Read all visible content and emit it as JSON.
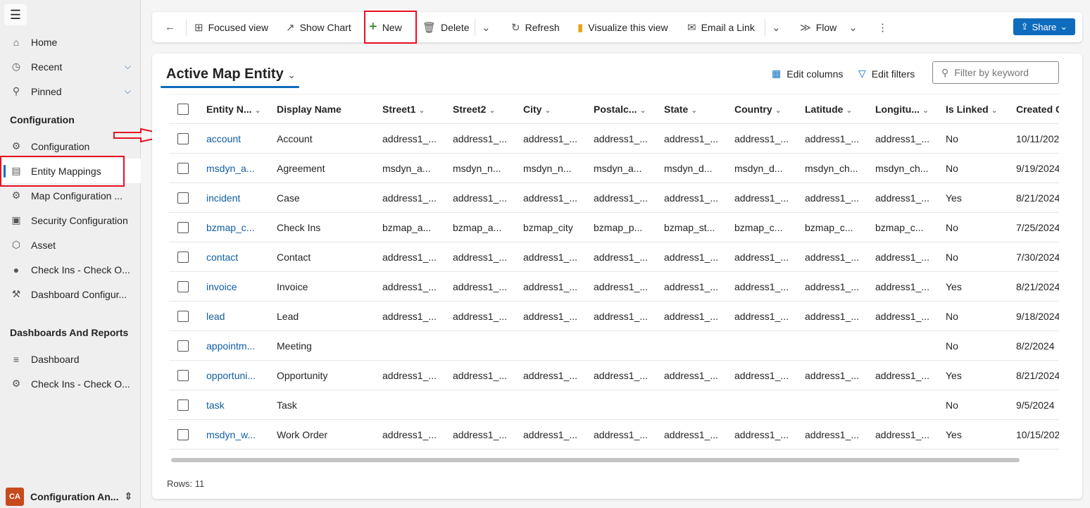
{
  "sidebar": {
    "items": [
      {
        "label": "Home",
        "icon": "home-icon"
      },
      {
        "label": "Recent",
        "icon": "clock-icon"
      },
      {
        "label": "Pinned",
        "icon": "pin-icon"
      }
    ],
    "section1": "Configuration",
    "config_items": [
      {
        "label": "Configuration",
        "icon": "clipboard-gear-icon"
      },
      {
        "label": "Entity Mappings",
        "icon": "document-icon"
      },
      {
        "label": "Map Configuration ...",
        "icon": "gear-icon"
      },
      {
        "label": "Security Configuration",
        "icon": "security-icon"
      },
      {
        "label": "Asset",
        "icon": "cube-icon"
      },
      {
        "label": "Check Ins - Check O...",
        "icon": "location-icon"
      },
      {
        "label": "Dashboard Configur...",
        "icon": "wrench-icon"
      }
    ],
    "section2": "Dashboards And Reports",
    "report_items": [
      {
        "label": "Dashboard",
        "icon": "dashboard-icon"
      },
      {
        "label": "Check Ins - Check O...",
        "icon": "clipboard-gear-icon"
      }
    ],
    "area_initials": "CA",
    "area_label": "Configuration An...",
    "accent": "#0f6cbd",
    "highlight": "#e81123"
  },
  "toolbar": {
    "focused": "Focused view",
    "chart": "Show Chart",
    "new": "New",
    "delete": "Delete",
    "refresh": "Refresh",
    "visualize": "Visualize this view",
    "email": "Email a Link",
    "flow": "Flow",
    "share": "Share"
  },
  "view": {
    "title": "Active Map Entity",
    "edit_columns": "Edit columns",
    "edit_filters": "Edit filters",
    "filter_placeholder": "Filter by keyword",
    "rows_label": "Rows: 11"
  },
  "columns": [
    "Entity N...",
    "Display Name",
    "Street1",
    "Street2",
    "City",
    "Postalc...",
    "State",
    "Country",
    "Latitude",
    "Longitu...",
    "Is Linked",
    "Created C"
  ],
  "rows": [
    [
      "account",
      "Account",
      "address1_...",
      "address1_...",
      "address1_...",
      "address1_...",
      "address1_...",
      "address1_...",
      "address1_...",
      "address1_...",
      "No",
      "10/11/202"
    ],
    [
      "msdyn_a...",
      "Agreement",
      "msdyn_a...",
      "msdyn_n...",
      "msdyn_n...",
      "msdyn_a...",
      "msdyn_d...",
      "msdyn_d...",
      "msdyn_ch...",
      "msdyn_ch...",
      "No",
      "9/19/2024"
    ],
    [
      "incident",
      "Case",
      "address1_...",
      "address1_...",
      "address1_...",
      "address1_...",
      "address1_...",
      "address1_...",
      "address1_...",
      "address1_...",
      "Yes",
      "8/21/2024"
    ],
    [
      "bzmap_c...",
      "Check Ins",
      "bzmap_a...",
      "bzmap_a...",
      "bzmap_city",
      "bzmap_p...",
      "bzmap_st...",
      "bzmap_c...",
      "bzmap_c...",
      "bzmap_c...",
      "No",
      "7/25/2024"
    ],
    [
      "contact",
      "Contact",
      "address1_...",
      "address1_...",
      "address1_...",
      "address1_...",
      "address1_...",
      "address1_...",
      "address1_...",
      "address1_...",
      "No",
      "7/30/2024"
    ],
    [
      "invoice",
      "Invoice",
      "address1_...",
      "address1_...",
      "address1_...",
      "address1_...",
      "address1_...",
      "address1_...",
      "address1_...",
      "address1_...",
      "Yes",
      "8/21/2024"
    ],
    [
      "lead",
      "Lead",
      "address1_...",
      "address1_...",
      "address1_...",
      "address1_...",
      "address1_...",
      "address1_...",
      "address1_...",
      "address1_...",
      "No",
      "9/18/2024"
    ],
    [
      "appointm...",
      "Meeting",
      "",
      "",
      "",
      "",
      "",
      "",
      "",
      "",
      "No",
      "8/2/2024"
    ],
    [
      "opportuni...",
      "Opportunity",
      "address1_...",
      "address1_...",
      "address1_...",
      "address1_...",
      "address1_...",
      "address1_...",
      "address1_...",
      "address1_...",
      "Yes",
      "8/21/2024"
    ],
    [
      "task",
      "Task",
      "",
      "",
      "",
      "",
      "",
      "",
      "",
      "",
      "No",
      "9/5/2024"
    ],
    [
      "msdyn_w...",
      "Work Order",
      "address1_...",
      "address1_...",
      "address1_...",
      "address1_...",
      "address1_...",
      "address1_...",
      "address1_...",
      "address1_...",
      "Yes",
      "10/15/202"
    ]
  ]
}
